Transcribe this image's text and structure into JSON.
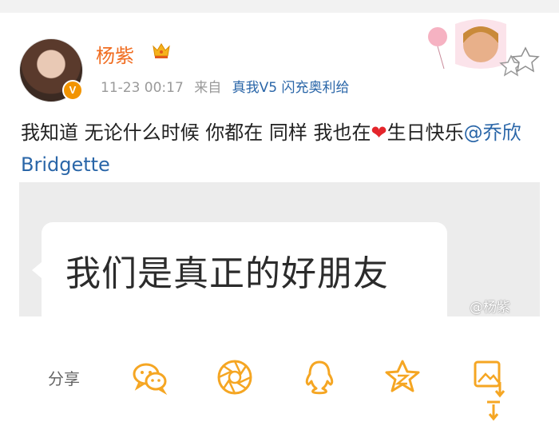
{
  "post": {
    "author_name": "杨紫",
    "timestamp": "11-23 00:17",
    "source_prefix": "来自",
    "source_device": "真我V5 闪充奥利给",
    "text_main": "我知道 无论什么时候 你都在 同样 我也在",
    "text_heart": "❤",
    "text_after_heart": "生日快乐",
    "mention": "@乔欣Bridgette",
    "verified_badge": "V"
  },
  "image": {
    "bubble_text": "我们是真正的好朋友",
    "watermark": "@杨紫"
  },
  "share": {
    "label": "分享",
    "icons": [
      "wechat-icon",
      "moments-icon",
      "qq-icon",
      "qzone-icon",
      "save-image-icon"
    ]
  },
  "colors": {
    "name": "#f06d21",
    "link": "#2a66a8",
    "share_icons": "#f5a623",
    "heart": "#e4252b"
  }
}
